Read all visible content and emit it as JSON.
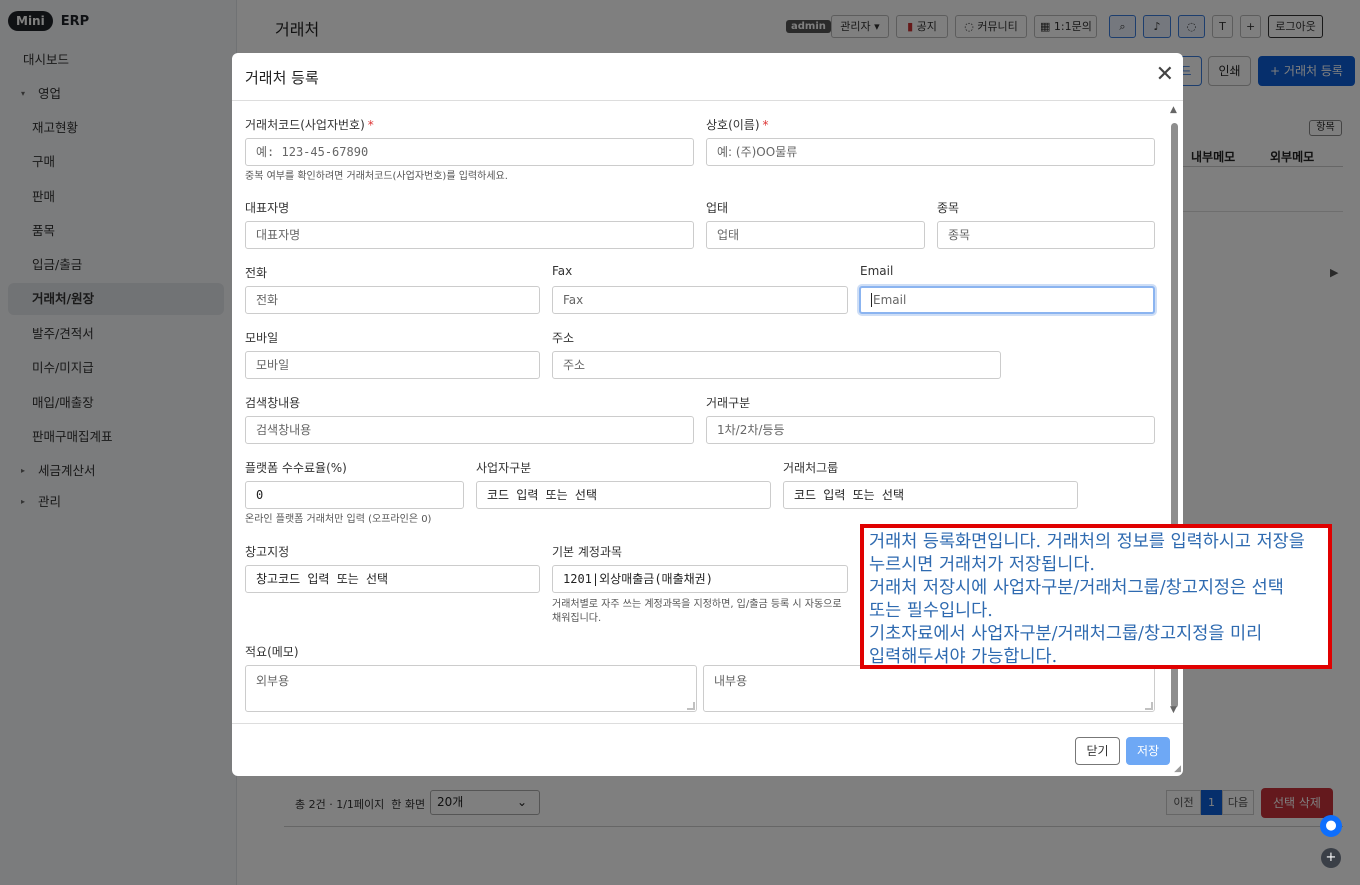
{
  "app": {
    "logo_badge": "Mini",
    "logo_text": "ERP"
  },
  "sidebar": {
    "items": [
      {
        "label": "대시보드"
      },
      {
        "label": "영업"
      },
      {
        "label": "재고현황"
      },
      {
        "label": "구매"
      },
      {
        "label": "판매"
      },
      {
        "label": "품목"
      },
      {
        "label": "입금/출금"
      },
      {
        "label": "거래처/원장"
      },
      {
        "label": "발주/견적서"
      },
      {
        "label": "미수/미지급"
      },
      {
        "label": "매입/매출장"
      },
      {
        "label": "판매구매집계표"
      },
      {
        "label": "세금계산서"
      },
      {
        "label": "관리"
      }
    ]
  },
  "header": {
    "page_title": "거래처",
    "admin_badge": "admin",
    "role_select": "관리자 ▾",
    "notice": "공지",
    "community": "커뮤니티",
    "inquiry": "1:1문의",
    "btn_t": "T",
    "btn_plus": "+",
    "logout": "로그아웃"
  },
  "toolbar": {
    "partial_label": "드",
    "print_label": "인쇄",
    "add_label": "+ 거래처 등록"
  },
  "table": {
    "items_button": "항목",
    "col_internal_memo": "내부메모",
    "col_external_memo": "외부메모"
  },
  "modal": {
    "title": "거래처 등록",
    "fields": {
      "code": {
        "label": "거래처코드(사업자번호)",
        "required": "*",
        "placeholder": "예: 123-45-67890",
        "hint": "중복 여부를 확인하려면 거래처코드(사업자번호)를 입력하세요."
      },
      "name": {
        "label": "상호(이름)",
        "required": "*",
        "placeholder": "예: (주)OO물류"
      },
      "ceo": {
        "label": "대표자명",
        "placeholder": "대표자명"
      },
      "biz_type": {
        "label": "업태",
        "placeholder": "업태"
      },
      "biz_item": {
        "label": "종목",
        "placeholder": "종목"
      },
      "phone": {
        "label": "전화",
        "placeholder": "전화"
      },
      "fax": {
        "label": "Fax",
        "placeholder": "Fax"
      },
      "email": {
        "label": "Email",
        "placeholder": "Email"
      },
      "mobile": {
        "label": "모바일",
        "placeholder": "모바일"
      },
      "address": {
        "label": "주소",
        "placeholder": "주소"
      },
      "search_text": {
        "label": "검색창내용",
        "placeholder": "검색창내용"
      },
      "trade_class": {
        "label": "거래구분",
        "placeholder": "1차/2차/등등"
      },
      "platform_fee": {
        "label": "플랫폼 수수료율(%)",
        "value": "0",
        "hint": "온라인 플랫폼 거래처만 입력 (오프라인은 0)"
      },
      "biz_class": {
        "label": "사업자구분",
        "placeholder": "코드 입력 또는 선택"
      },
      "client_group": {
        "label": "거래처그룹",
        "placeholder": "코드 입력 또는 선택"
      },
      "warehouse": {
        "label": "창고지정",
        "placeholder": "창고코드 입력 또는 선택"
      },
      "account": {
        "label": "기본 계정과목",
        "value": "1201|외상매출금(매출채권)",
        "hint": "거래처별로 자주 쓰는 계정과목을 지정하면, 입/출금 등록 시 자동으로 채워집니다."
      },
      "memo": {
        "label": "적요(메모)",
        "external_placeholder": "외부용",
        "internal_placeholder": "내부용"
      }
    },
    "close_label": "닫기",
    "save_label": "저장"
  },
  "callout": {
    "lines": [
      "거래처 등록화면입니다. 거래처의 정보를 입력하시고 저장을 누르시면 거래처가 저장됩니다.",
      "거래처 저장시에 사업자구분/거래처그룹/창고지정은 선택 또는 필수입니다.",
      "기초자료에서 사업자구분/거래처그룹/창고지정을 미리 입력해두셔야 가능합니다."
    ]
  },
  "pagination": {
    "summary": "총 2건 · 1/1페이지",
    "per_page_label": "한 화면",
    "per_page_value": "20개",
    "prev": "이전",
    "page": "1",
    "next": "다음",
    "delete_selected": "선택 삭제"
  },
  "colors": {
    "primary": "#0d5fd8",
    "danger": "#c8323a",
    "callout_border": "#e00000",
    "callout_text": "#2e6ab0"
  }
}
